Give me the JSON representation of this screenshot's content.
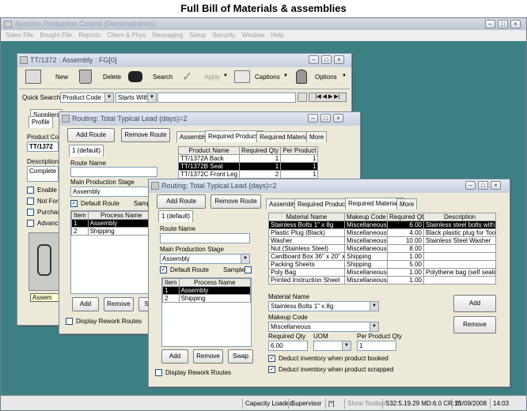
{
  "headline": "Full Bill of Materials & assemblies",
  "app": {
    "title": "Synchro Production Control (Demonstration)",
    "menu": [
      "Sales File",
      "Bought File",
      "Reports",
      "Chem & Phys",
      "Messaging",
      "Setup",
      "Security",
      "Window",
      "Help"
    ],
    "status": {
      "capacity": "Capacity Loaded",
      "user": "Supervisor",
      "flag": "[*]",
      "toolbar": "Show Toolbar",
      "metrics": "S32:5.19.29 MD:6.0 CR:10",
      "date": "21/09/2008",
      "time": "14:03"
    }
  },
  "assembly_window": {
    "title": "TT/1372 : Assembly : FG[0]",
    "toolbar": {
      "new": "New",
      "delete": "Delete",
      "search": "Search",
      "apply": "Apply",
      "captions": "Captions",
      "options": "Options"
    },
    "quick_search_label": "Quick Search",
    "quick_search_field": "Product Code",
    "quick_search_mode": "Starts With",
    "tabs": [
      "Suppliers",
      "Profile"
    ],
    "product_code_label": "Product Co",
    "product_code_value": "TT/1372",
    "description_label": "Description",
    "description_value": "Complete P",
    "checks": [
      "Enable u",
      "Not For I",
      "Purchas",
      "Advance"
    ],
    "image_caption": "Assem"
  },
  "routing1": {
    "title": "Routing: Total Typical Lead (days)=2",
    "add_route": "Add Route",
    "remove_route": "Remove Route",
    "route_selector": "1 (default)",
    "route_name_label": "Route Name",
    "main_stage_label": "Main Production Stage",
    "main_stage_value": "Assembly",
    "default_route": "Default Route",
    "sample": "Samp",
    "process_headers": [
      "Item",
      "Process Name"
    ],
    "processes": [
      {
        "item": "1",
        "name": "Assembly"
      },
      {
        "item": "2",
        "name": "Shipping"
      }
    ],
    "add": "Add",
    "remove": "Remove",
    "swap": "S",
    "display_rework": "Display Rework Routes",
    "tabs": [
      "Assembly",
      "Required Products",
      "Required Materials",
      "More"
    ],
    "product_headers": [
      "Product Name",
      "Required Qty",
      "Per Product"
    ],
    "products": [
      {
        "name": "TT/1372A Back",
        "qty": "1",
        "per": "1"
      },
      {
        "name": "TT/1372B Seat",
        "qty": "1",
        "per": "1"
      },
      {
        "name": "TT/1372C Front Leg",
        "qty": "2",
        "per": "1"
      }
    ]
  },
  "routing2": {
    "title": "Routing: Total Typical Lead (days)=2",
    "add_route": "Add Route",
    "remove_route": "Remove Route",
    "route_selector": "1 (default)",
    "route_name_label": "Route Name",
    "main_stage_label": "Main Production Stage",
    "main_stage_value": "Assembly",
    "default_route": "Default Route",
    "sample": "Sample",
    "process_headers": [
      "Item",
      "Process Name"
    ],
    "processes": [
      {
        "item": "1",
        "name": "Assembly"
      },
      {
        "item": "2",
        "name": "Shipping"
      }
    ],
    "add": "Add",
    "remove": "Remove",
    "swap": "Swap",
    "display_rework": "Display Rework Routes",
    "tabs": [
      "Assembly",
      "Required Products",
      "Required Materials",
      "More"
    ],
    "material_headers": [
      "Material Name",
      "Makeup Code",
      "Required Qty",
      "Description"
    ],
    "materials": [
      {
        "name": "Stainless Bolts 1\" x 8g",
        "code": "Miscellaneous",
        "qty": "6.00",
        "desc": "Stainless steel bolts with cap"
      },
      {
        "name": "Plastic Plug (Black)",
        "code": "Miscellaneous",
        "qty": "4.00",
        "desc": "Black plastic plug for 'foot' o"
      },
      {
        "name": "Washer",
        "code": "Miscellaneous",
        "qty": "10.00",
        "desc": "Stainless Steel Washer"
      },
      {
        "name": "Nut (Stainless Steel)",
        "code": "Miscellaneous",
        "qty": "8.00",
        "desc": ""
      },
      {
        "name": "Cardboard Box 36\" x 20\" x 6\"",
        "code": "Shipping",
        "qty": "1.00",
        "desc": ""
      },
      {
        "name": "Packing Sheets",
        "code": "Shipping",
        "qty": "5.00",
        "desc": ""
      },
      {
        "name": "Poly Bag",
        "code": "Miscellaneous",
        "qty": "1.00",
        "desc": "Polythene bag (self sealing)"
      },
      {
        "name": "Printed Instruction Sheet",
        "code": "Miscellaneous",
        "qty": "1.00",
        "desc": ""
      }
    ],
    "material_label": "Material Name",
    "material_value": "Stainless Bolts 1\" x 8g",
    "makeup_label": "Makeup Code",
    "makeup_value": "Miscellaneous",
    "req_qty_label": "Required Qty",
    "req_qty_value": "6.00",
    "uom_label": "UOM",
    "uom_value": "",
    "per_product_label": "Per Product Qty",
    "per_product_value": "1",
    "deduct_booked": "Deduct inventory when product booked",
    "deduct_scrapped": "Deduct inventory when product scrapped",
    "add_button": "Add",
    "remove_button": "Remove"
  }
}
